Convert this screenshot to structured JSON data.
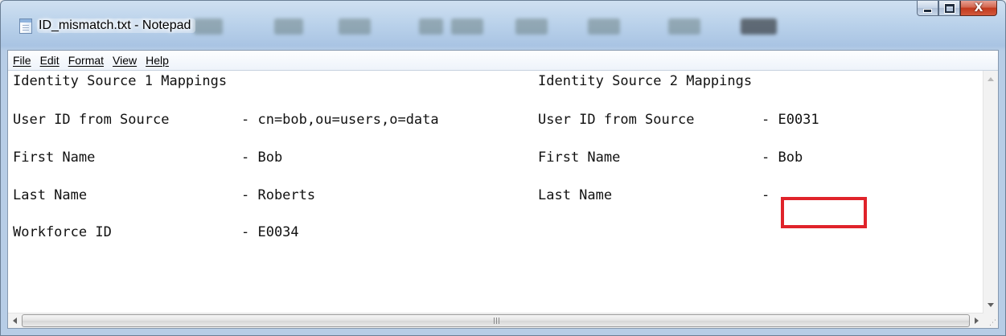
{
  "window": {
    "title": "ID_mismatch.txt - Notepad"
  },
  "caption_buttons": {
    "close_glyph": "X"
  },
  "menu": {
    "items": [
      "File",
      "Edit",
      "Format",
      "View",
      "Help"
    ]
  },
  "document": {
    "source1": {
      "heading": "Identity Source 1 Mappings",
      "rows": [
        {
          "label": "User ID from Source",
          "value": "- cn=bob,ou=users,o=data"
        },
        {
          "label": "First Name",
          "value": "- Bob"
        },
        {
          "label": "Last Name",
          "value": "- Roberts"
        },
        {
          "label": "Workforce ID",
          "value": "- E0034"
        }
      ]
    },
    "source2": {
      "heading": "Identity Source 2 Mappings",
      "rows": [
        {
          "label": "User ID from Source",
          "value": "- E0031"
        },
        {
          "label": "First Name",
          "value": "- Bob"
        },
        {
          "label": "Last Name",
          "value": "-"
        }
      ]
    }
  },
  "annotation": {
    "highlight_color": "#e0232a"
  },
  "icons": {
    "app": "notepad-icon",
    "minimize": "minimize-icon",
    "maximize": "maximize-icon",
    "close": "close-icon",
    "scroll_up": "arrow-up-icon",
    "scroll_down": "arrow-down-icon",
    "scroll_left": "arrow-left-icon",
    "scroll_right": "arrow-right-icon",
    "size_grip": "size-grip-icon"
  }
}
